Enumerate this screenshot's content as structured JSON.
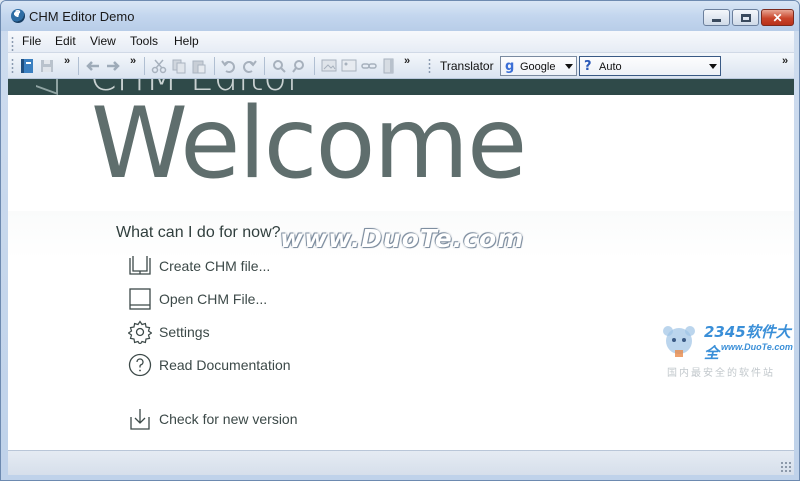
{
  "window": {
    "title": "CHM Editor Demo"
  },
  "menu": [
    "File",
    "Edit",
    "View",
    "Tools",
    "Help"
  ],
  "toolbar": {
    "overflow_label": "»",
    "translator_label": "Translator",
    "engine": {
      "value": "Google",
      "icon": "google-g-icon"
    },
    "language": {
      "value": "Auto",
      "icon": "help-question-icon"
    }
  },
  "header": {
    "brand": "CHM Editor",
    "welcome": "Welcome"
  },
  "main": {
    "question": "What can I do for now?",
    "actions": [
      {
        "label": "Create CHM file...",
        "icon": "book-open-icon"
      },
      {
        "label": "Open CHM File...",
        "icon": "book-closed-icon"
      },
      {
        "label": "Settings",
        "icon": "gear-icon"
      },
      {
        "label": "Read Documentation",
        "icon": "question-circle-icon"
      },
      {
        "label": "Check for new version",
        "icon": "download-arrow-icon"
      }
    ]
  },
  "watermarks": {
    "duote": "www.DuoTe.com",
    "site_logo": "2345软件大全",
    "site_url": "www.DuoTe.com",
    "site_caption": "国内最安全的软件站"
  }
}
